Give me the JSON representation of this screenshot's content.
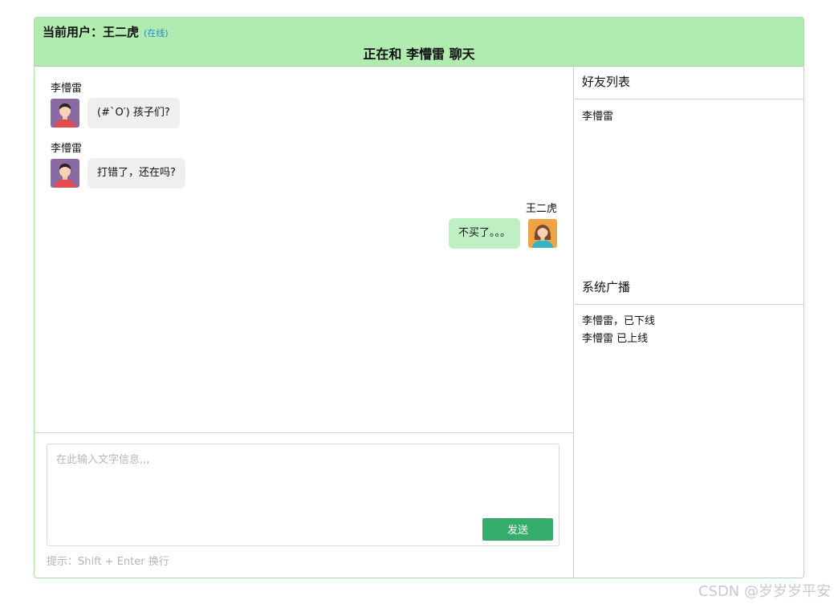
{
  "header": {
    "current_user_label": "当前用户：",
    "current_user_name": "王二虎",
    "status": "(在线)",
    "chat_title": "正在和 李懵雷 聊天"
  },
  "messages": [
    {
      "sender": "李懵雷",
      "text": "(#`O′) 孩子们?",
      "side": "left",
      "avatar": "male-avatar-icon"
    },
    {
      "sender": "李懵雷",
      "text": "打错了，还在吗?",
      "side": "left",
      "avatar": "male-avatar-icon"
    },
    {
      "sender": "王二虎",
      "text": "不买了。。。",
      "side": "right",
      "avatar": "female-avatar-icon"
    }
  ],
  "composer": {
    "placeholder": "在此输入文字信息,,,",
    "value": "",
    "send_label": "发送",
    "hint": "提示：Shift + Enter 换行"
  },
  "friends": {
    "title": "好友列表",
    "items": [
      "李懵雷"
    ]
  },
  "broadcast": {
    "title": "系统广播",
    "items": [
      "李懵雷，已下线",
      "李懵雷 已上线"
    ]
  },
  "watermark": "CSDN @岁岁岁平安",
  "colors": {
    "header_bg": "#b0ebb0",
    "border": "#a9dea9",
    "send_button": "#37ad6b",
    "own_bubble": "#bff0c4",
    "other_bubble": "#efefef",
    "status_text": "#2a87d0"
  }
}
